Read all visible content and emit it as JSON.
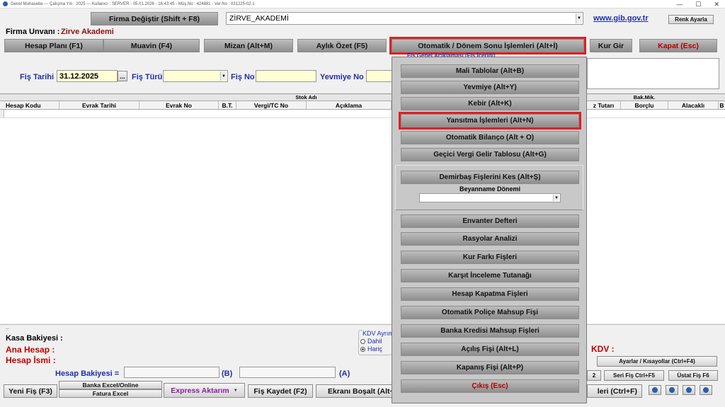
{
  "window": {
    "title": "Genel Muhasebe  ---  Çalışma Yılı : 2025  ---  Kullanıcı : SERVER - 05.01.2026 - 16:43:45 - Müş.No : 424881 - Ver.No : 031225-02.1"
  },
  "header": {
    "firma_degistir": "Firma Değiştir (Shift + F8)",
    "company_combo": "ZİRVE_AKADEMİ",
    "gib_link": "www.gib.gov.tr",
    "renk_ayarla": "Renk Ayarla",
    "firma_unvani_label": "Firma Unvanı :",
    "firma_unvani_value": "Zirve Akademi"
  },
  "toolbar": {
    "hesap_plani": "Hesap Planı (F1)",
    "muavin": "Muavin (F4)",
    "mizan": "Mizan (Alt+M)",
    "aylik_ozet": "Aylık Özet (F5)",
    "otomatik": "Otomatik / Dönem Sonu İşlemleri (Alt+İ)",
    "kur_gir": "Kur Gir",
    "kapat": "Kapat (Esc)"
  },
  "fis": {
    "tarih_label": "Fiş Tarihi",
    "tarih_value": "31.12.2025",
    "tarih_btn": "...",
    "turu_label": "Fiş Türü",
    "no_label": "Fiş No",
    "yevmiye_label": "Yevmiye No",
    "genel_aciklama": "Fiş Genel Açıklaması (Fiş İçeriği)"
  },
  "grid": {
    "top_headers": {
      "stok_adi": "Stok Adı",
      "bak_mik": "Bak.Mik."
    },
    "columns": [
      "Hesap Kodu",
      "Evrak Tarihi",
      "Evrak No",
      "B.T.",
      "Vergi/TC No",
      "Açıklama",
      "z Tutarı",
      "Borçlu",
      "Alacaklı",
      "B"
    ]
  },
  "menu": {
    "items": [
      "Mali Tablolar (Alt+B)",
      "Yevmiye (Alt+Y)",
      "Kebir (Alt+K)",
      "Yansıtma İşlemleri (Alt+N)",
      "Otomatik Bilanço (Alt + O)",
      "Geçici Vergi Gelir Tablosu (Alt+G)",
      "Demirbaş Fişlerini Kes (Alt+Ş)",
      "Envanter Defteri",
      "Rasyolar Analizi",
      "Kur Farkı Fişleri",
      "Karşıt İnceleme Tutanağı",
      "Hesap Kapatma Fişleri",
      "Otomatik Poliçe Mahsup Fişi",
      "Banka Kredisi Mahsup Fişleri",
      "Açılış Fişi (Alt+L)",
      "Kapanış Fişi (Alt+P)",
      "Çıkış (Esc)"
    ],
    "beyanname_label": "Beyanname Dönemi"
  },
  "footer": {
    "kasa_bakiyesi": "Kasa Bakiyesi :",
    "ana_hesap": "Ana Hesap :",
    "hesap_ismi": "Hesap İsmi :",
    "hesap_bakiyesi": "Hesap Bakiyesi =",
    "b_label": "(B)",
    "a_label": "(A)",
    "kdv_ayrim": "KDV Ayrımı",
    "dahil": "Dahil",
    "haric": "Hariç",
    "kdv_label": "KDV :",
    "ayarlar": "Ayarlar / Kısayollar (Ctrl+F4)",
    "btn_2": "2",
    "seri_fis": "Seri Fiş Ctrl+F5",
    "ustat_fis": "Üstat Fiş F6",
    "yeni_fis": "Yeni Fiş (F3)",
    "banka_excel": "Banka Excel/Online",
    "fatura_excel": "Fatura Excel",
    "express": "Express Aktarım",
    "fis_kaydet": "Fiş Kaydet (F2)",
    "ekrani_bosalt": "Ekranı Boşalt (Alt+",
    "ctrl_f": "leri (Ctrl+F)"
  }
}
